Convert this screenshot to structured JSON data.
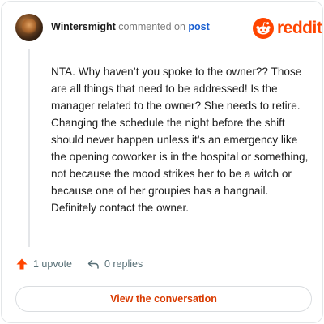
{
  "comment": {
    "username": "Wintersmight",
    "action_text": "commented on",
    "post_link_text": "post",
    "body": "NTA. Why haven’t you spoke to the owner?? Those are all things that need to be addressed! Is the manager related to the owner? She needs to retire. Changing the schedule the night before the shift should never happen unless it’s an emergency like the opening coworker is in the hospital or something, not because the mood strikes her to be a witch or because one of her groupies has a hangnail. Definitely contact the owner."
  },
  "brand": {
    "name": "reddit",
    "color": "#ff4500"
  },
  "actions": {
    "upvote_label": "1 upvote",
    "upvote_icon": "upvote-arrow-icon",
    "upvote_color": "#ff4500",
    "replies_label": "0 replies",
    "replies_icon": "reply-arrow-icon"
  },
  "cta": {
    "label": "View the conversation",
    "color": "#d93a00"
  }
}
